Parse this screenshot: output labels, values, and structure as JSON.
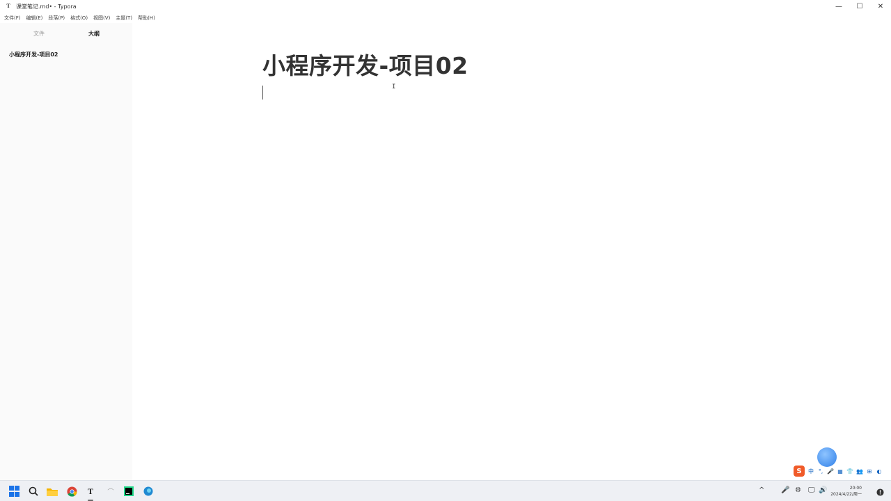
{
  "window": {
    "title": "课堂笔记.md• - Typora",
    "app_icon": "T",
    "controls": [
      "—",
      "☐",
      "✕"
    ]
  },
  "menu": [
    "文件(F)",
    "编辑(E)",
    "段落(P)",
    "格式(O)",
    "视图(V)",
    "主题(T)",
    "帮助(H)"
  ],
  "sidebar": {
    "tabs": {
      "files": "文件",
      "outline": "大纲"
    },
    "active_tab": "outline",
    "outline_items": [
      "小程序开发-项目02"
    ],
    "footer": {
      "back": "‹",
      "source": "</>"
    }
  },
  "editor": {
    "heading": "小程序开发-项目02",
    "cursor_glyph": "I"
  },
  "ime": {
    "logo": "S",
    "icons": [
      "中",
      "°,",
      "🎤",
      "▦",
      "👕",
      "👥",
      "⊞",
      "◐"
    ]
  },
  "taskbar": {
    "icons": [
      "windows-start",
      "search",
      "file-explorer",
      "chrome",
      "typora",
      "app",
      "pycharm",
      "edge"
    ],
    "tray_icons": [
      "^",
      "🎤",
      "⚙",
      "🖵",
      "🔊"
    ],
    "time": "20:00",
    "date": "2024/4/22/周一"
  },
  "colors": {
    "accent": "#1a73e8",
    "ime": "#f05a28"
  }
}
